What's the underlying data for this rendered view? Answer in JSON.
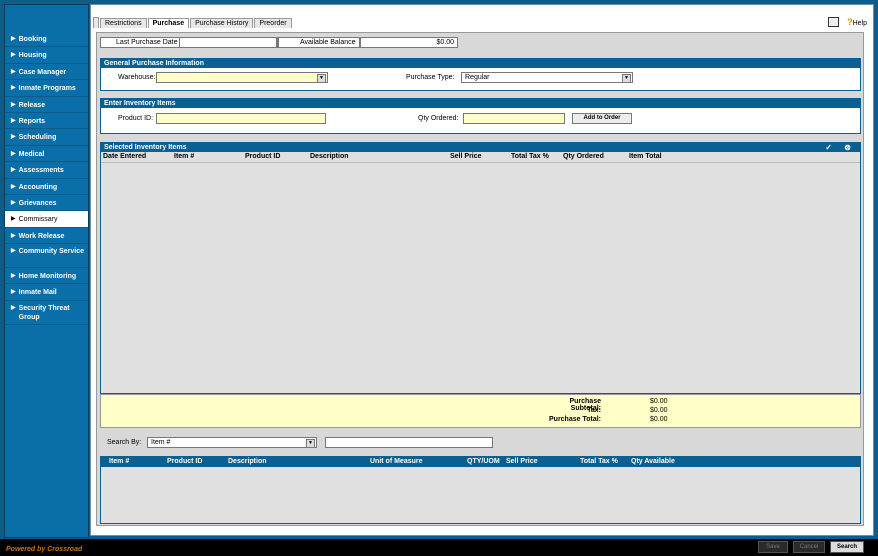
{
  "sidebar": {
    "items": [
      {
        "label": "Booking",
        "active": false
      },
      {
        "label": "Housing",
        "active": false
      },
      {
        "label": "Case Manager",
        "active": false
      },
      {
        "label": "Inmate Programs",
        "active": false
      },
      {
        "label": "Release",
        "active": false
      },
      {
        "label": "Reports",
        "active": false
      },
      {
        "label": "Scheduling",
        "active": false
      },
      {
        "label": "Medical",
        "active": false
      },
      {
        "label": "Assessments",
        "active": false
      },
      {
        "label": "Accounting",
        "active": false
      },
      {
        "label": "Grievances",
        "active": false
      },
      {
        "label": "Commissary",
        "active": true
      },
      {
        "label": "Work Release",
        "active": false
      },
      {
        "label": "Community Service",
        "active": false
      },
      {
        "label": "Home Monitoring",
        "active": false
      },
      {
        "label": "Inmate Mail",
        "active": false
      },
      {
        "label": "Security Threat Group",
        "active": false
      }
    ]
  },
  "tabs": [
    {
      "label": "Restrictions",
      "active": false
    },
    {
      "label": "Purchase",
      "active": true
    },
    {
      "label": "Purchase History",
      "active": false
    },
    {
      "label": "Preorder",
      "active": false
    }
  ],
  "help": {
    "label": "Help"
  },
  "summary": {
    "last_purchase_label": "Last Purchase Date",
    "last_purchase_value": "",
    "balance_label": "Available Balance",
    "balance_value": "$0.00"
  },
  "general": {
    "title": "General Purchase Information",
    "warehouse_label": "Warehouse:",
    "warehouse_value": "",
    "purchase_type_label": "Purchase Type:",
    "purchase_type_value": "Regular"
  },
  "inventory_entry": {
    "title": "Enter Inventory Items",
    "product_id_label": "Product ID:",
    "product_id_value": "",
    "qty_label": "Qty Ordered:",
    "qty_value": "",
    "add_button": "Add to Order"
  },
  "selected": {
    "title": "Selected Inventory Items",
    "columns": [
      "Date Entered",
      "Item #",
      "Product ID",
      "Description",
      "Sell Price",
      "Total Tax %",
      "Qty Ordered",
      "Item Total"
    ],
    "rows": []
  },
  "totals": {
    "subtotal_label": "Purchase Subtotal:",
    "subtotal_value": "$0.00",
    "tax_label": "Tax:",
    "tax_value": "$0.00",
    "total_label": "Purchase Total:",
    "total_value": "$0.00"
  },
  "search": {
    "label": "Search By:",
    "by_value": "Item #",
    "text_value": ""
  },
  "results": {
    "columns": [
      "Item #",
      "Product ID",
      "Description",
      "Unit of Measure",
      "QTY/UOM",
      "Sell Price",
      "Total Tax %",
      "Qty Available"
    ],
    "rows": []
  },
  "footer": {
    "powered_by": "Powered by Crossroad",
    "buttons": [
      "Save",
      "Cancel",
      "Search"
    ]
  }
}
